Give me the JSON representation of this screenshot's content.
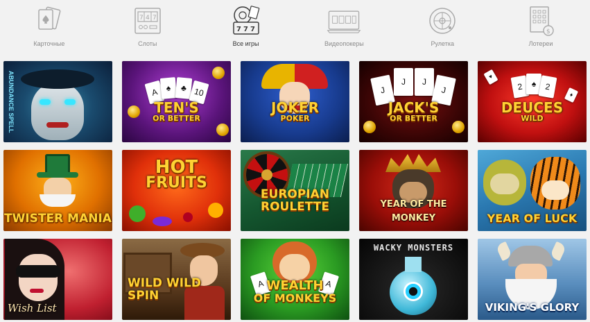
{
  "categories": [
    {
      "label": "Карточные",
      "icon": "playing-cards-icon",
      "active": false
    },
    {
      "label": "Слоты",
      "icon": "slot-machine-icon",
      "active": false
    },
    {
      "label": "Все игры",
      "icon": "all-games-icon",
      "active": true
    },
    {
      "label": "Видеопокеры",
      "icon": "video-poker-icon",
      "active": false
    },
    {
      "label": "Рулетка",
      "icon": "roulette-icon",
      "active": false
    },
    {
      "label": "Лотереи",
      "icon": "lottery-ticket-icon",
      "active": false
    }
  ],
  "games": [
    {
      "title": "ABUNDANCE SPELL"
    },
    {
      "title": "TEN'S",
      "subtitle": "OR BETTER"
    },
    {
      "title": "JOKER",
      "subtitle": "POKER"
    },
    {
      "title": "JACK'S",
      "subtitle": "OR BETTER"
    },
    {
      "title": "DEUCES",
      "subtitle": "WILD"
    },
    {
      "title": "TWISTER MANIA"
    },
    {
      "title": "HOT",
      "subtitle": "FRUITS"
    },
    {
      "title": "EUROPIAN",
      "subtitle": "ROULETTE"
    },
    {
      "title": "YEAR OF THE MONKEY"
    },
    {
      "title": "YEAR OF LUCK"
    },
    {
      "title": "Wish List"
    },
    {
      "title": "WILD WILD",
      "subtitle": "SPIN"
    },
    {
      "title": "WEALTH",
      "subtitle": "OF MONKEYS"
    },
    {
      "title": "WACKY MONSTERS"
    },
    {
      "title": "VIKING'S GLORY"
    }
  ],
  "colors": {
    "icon_inactive": "#a9a9a9",
    "icon_active": "#3a3a3a",
    "title_gold": "#ffd233"
  }
}
